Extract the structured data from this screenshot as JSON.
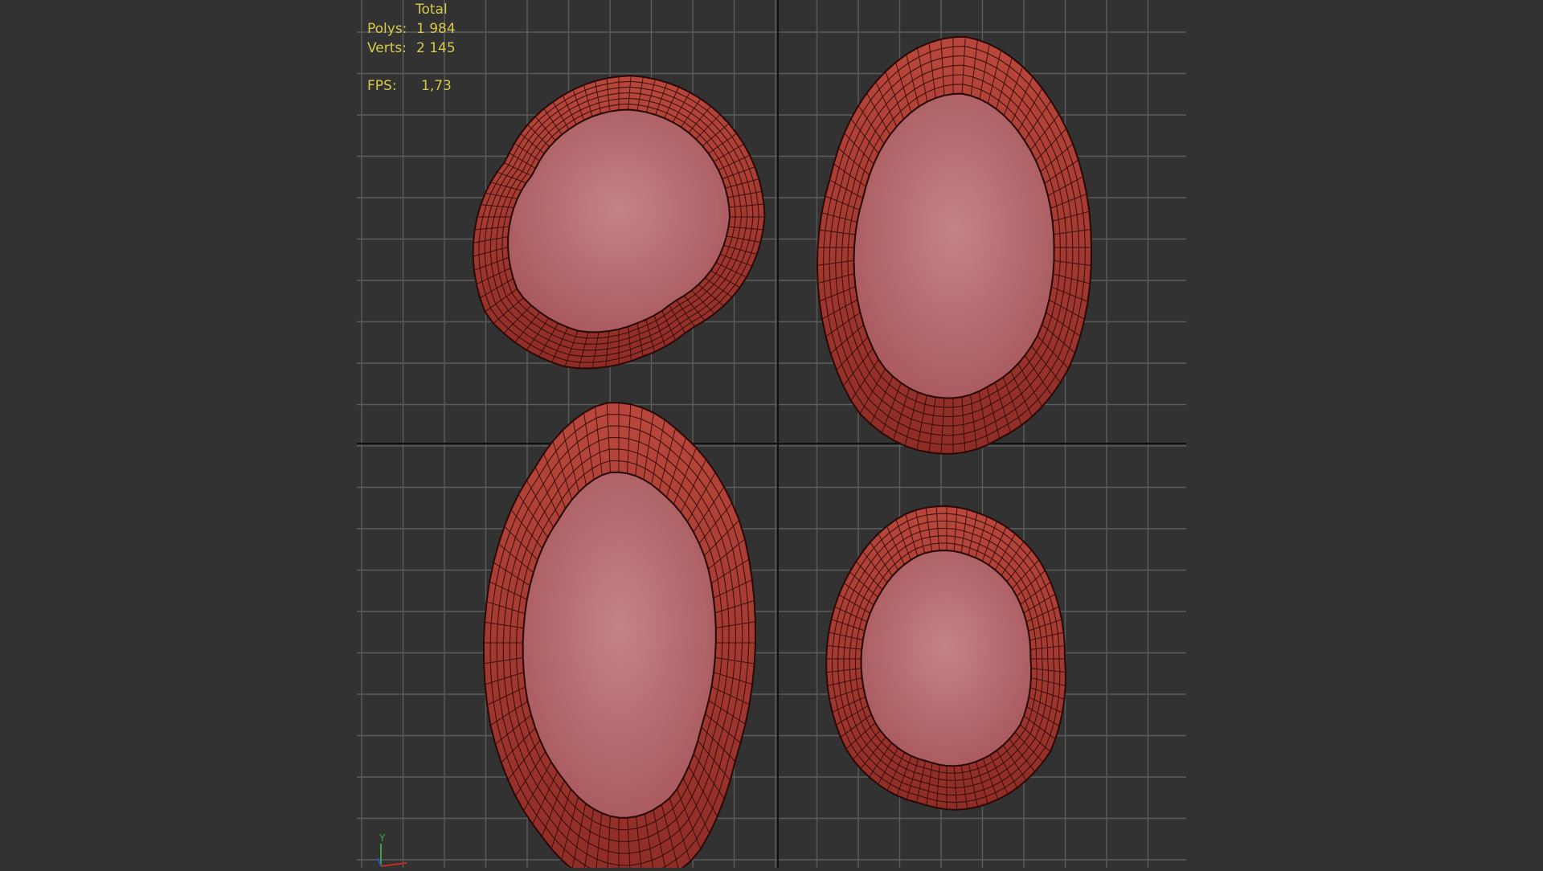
{
  "viewport": {
    "stats": {
      "header": "Total",
      "polys_label": "Polys:",
      "polys_value": "1 984",
      "verts_label": "Verts:",
      "verts_value": "2 145",
      "fps_label": "FPS:",
      "fps_value": "1,73"
    },
    "gizmo": {
      "y_label": "Y"
    },
    "colors": {
      "background": "#323232",
      "grid": "#5c5c5c",
      "axis": "#111111",
      "mesh": "#a83a32",
      "mesh_wire": "#2a0906",
      "mesh_inner": "#b86e70",
      "stats_text": "#d6c94a",
      "axis_x": "#c03020",
      "axis_y": "#40a040",
      "axis_z": "#3050c0"
    },
    "objects": [
      {
        "name": "ring-top-left"
      },
      {
        "name": "ring-top-right"
      },
      {
        "name": "ring-bottom-left"
      },
      {
        "name": "ring-bottom-right"
      }
    ]
  }
}
